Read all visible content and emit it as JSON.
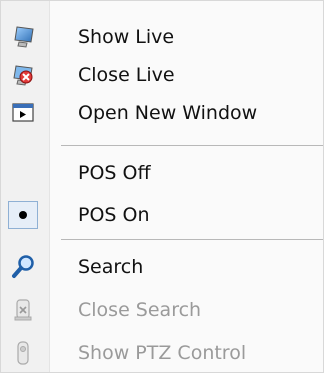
{
  "menu": {
    "items": [
      {
        "label": "Show Live",
        "icon": "monitor-icon",
        "enabled": true
      },
      {
        "label": "Close Live",
        "icon": "close-live-icon",
        "enabled": true
      },
      {
        "label": "Open New Window",
        "icon": "new-window-icon",
        "enabled": true
      },
      {
        "label": "POS Off",
        "icon": "",
        "enabled": true
      },
      {
        "label": "POS On",
        "icon": "radio-dot",
        "enabled": true,
        "checked": true
      },
      {
        "label": "Search",
        "icon": "magnifier-icon",
        "enabled": true
      },
      {
        "label": "Close Search",
        "icon": "close-search-icon",
        "enabled": false
      },
      {
        "label": "Show PTZ Control",
        "icon": "ptz-camera-icon",
        "enabled": false
      }
    ]
  }
}
